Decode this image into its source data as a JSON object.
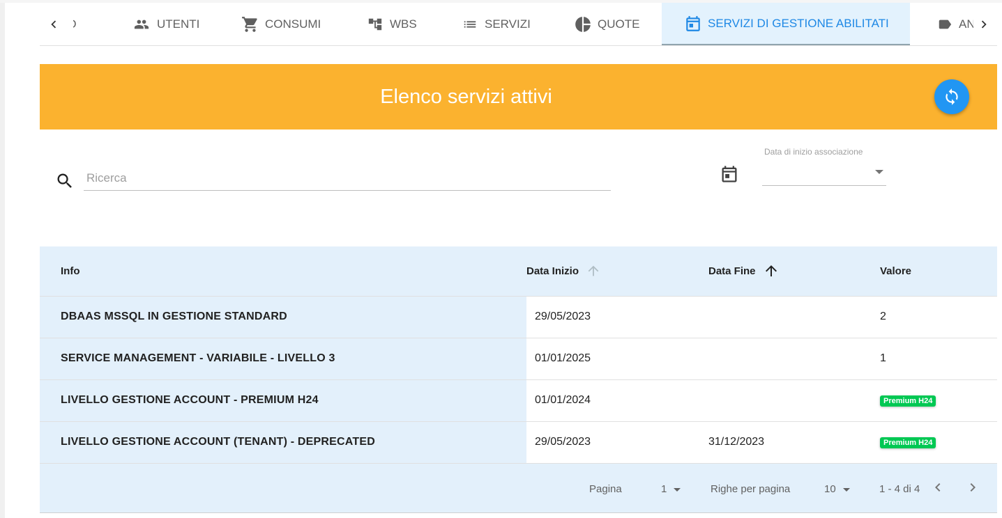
{
  "tabs": [
    {
      "label": "GLIO",
      "icon": "info-icon"
    },
    {
      "label": "UTENTI",
      "icon": "people-icon"
    },
    {
      "label": "CONSUMI",
      "icon": "cart-icon"
    },
    {
      "label": "WBS",
      "icon": "tree-icon"
    },
    {
      "label": "SERVIZI",
      "icon": "list-icon"
    },
    {
      "label": "QUOTE",
      "icon": "pie-icon"
    },
    {
      "label": "SERVIZI DI GESTIONE ABILITATI",
      "icon": "calendar-icon",
      "active": true
    },
    {
      "label": "AN",
      "icon": "label-icon"
    }
  ],
  "banner": {
    "title": "Elenco servizi attivi",
    "refresh_icon": "refresh-icon"
  },
  "filter": {
    "search_placeholder": "Ricerca",
    "date_label": "Data di inizio associazione",
    "date_value": ""
  },
  "table": {
    "headers": {
      "info": "Info",
      "start": "Data Inizio",
      "end": "Data Fine",
      "value": "Valore"
    },
    "rows": [
      {
        "info": "DBAAS MSSQL IN GESTIONE STANDARD",
        "start": "29/05/2023",
        "end": "",
        "value": "2"
      },
      {
        "info": "SERVICE MANAGEMENT - VARIABILE - LIVELLO 3",
        "start": "01/01/2025",
        "end": "",
        "value": "1"
      },
      {
        "info": "LIVELLO GESTIONE ACCOUNT - PREMIUM H24",
        "start": "01/01/2024",
        "end": "",
        "badge": "Premium H24"
      },
      {
        "info": "LIVELLO GESTIONE ACCOUNT (TENANT) - DEPRECATED",
        "start": "29/05/2023",
        "end": "31/12/2023",
        "badge": "Premium H24"
      }
    ]
  },
  "pager": {
    "page_label": "Pagina",
    "page_value": "1",
    "rows_label": "Righe per pagina",
    "rows_value": "10",
    "range": "1 - 4 di 4"
  },
  "colors": {
    "banner": "#fbb22f",
    "accent": "#1e88e5",
    "badge": "#00c853",
    "table_bg": "#e3f0fb"
  }
}
